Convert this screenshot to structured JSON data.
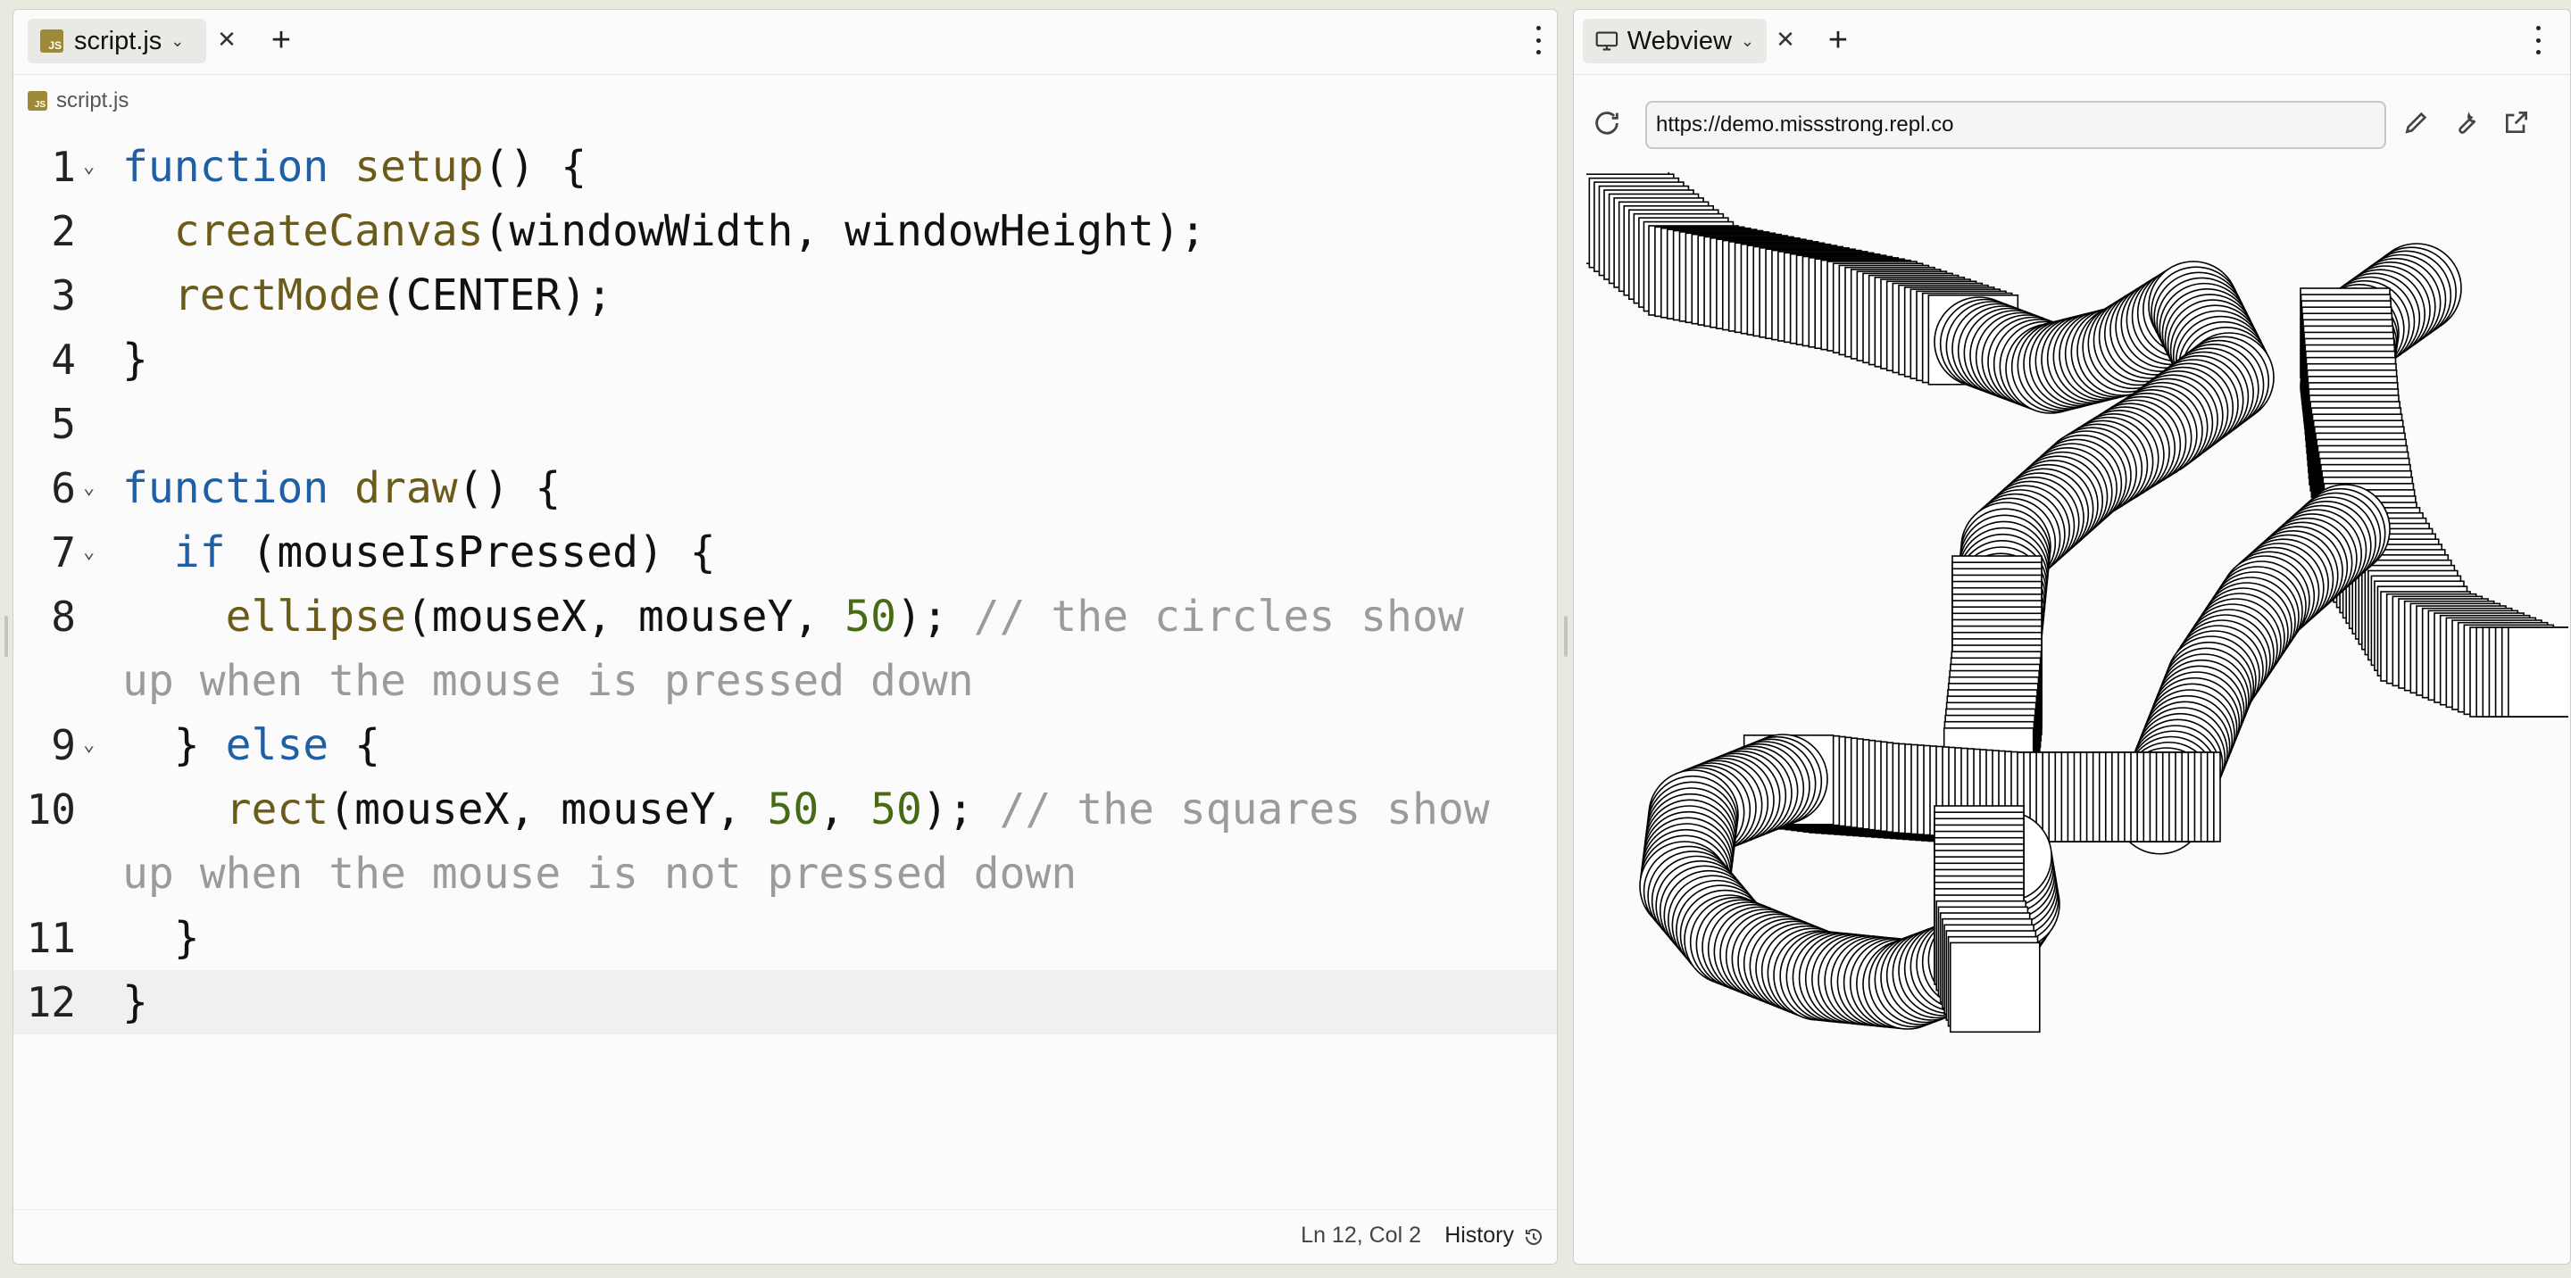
{
  "editor": {
    "tab": {
      "label": "script.js",
      "icon": "js-file-icon",
      "icon_text": "JS"
    },
    "breadcrumb": "script.js",
    "active_line": 12,
    "lines": [
      {
        "num": "1",
        "fold": true
      },
      {
        "num": "2",
        "fold": false
      },
      {
        "num": "3",
        "fold": false
      },
      {
        "num": "4",
        "fold": false
      },
      {
        "num": "5",
        "fold": false
      },
      {
        "num": "6",
        "fold": true
      },
      {
        "num": "7",
        "fold": true
      },
      {
        "num": "8",
        "fold": false
      },
      {
        "num": "9",
        "fold": true
      },
      {
        "num": "10",
        "fold": false
      },
      {
        "num": "11",
        "fold": false
      },
      {
        "num": "12",
        "fold": false
      }
    ],
    "code": {
      "l1": [
        "function",
        " ",
        "setup",
        "() {"
      ],
      "l2": [
        "  ",
        "createCanvas",
        "(windowWidth, windowHeight);"
      ],
      "l3": [
        "  ",
        "rectMode",
        "(CENTER);"
      ],
      "l4": [
        "}"
      ],
      "l6": [
        "function",
        " ",
        "draw",
        "() {"
      ],
      "l7": [
        "  ",
        "if",
        " (mouseIsPressed) {"
      ],
      "l8": [
        "    ",
        "ellipse",
        "(mouseX, mouseY, ",
        "50",
        "); ",
        "// the circles show up when the mouse is pressed down"
      ],
      "l9": [
        "  } ",
        "else",
        " {"
      ],
      "l10": [
        "    ",
        "rect",
        "(mouseX, mouseY, ",
        "50",
        ", ",
        "50",
        "); ",
        "// the squares show up when the mouse is not pressed down"
      ],
      "l11": [
        "  }"
      ],
      "l12": [
        "}"
      ]
    },
    "status": {
      "position": "Ln 12, Col 2",
      "history_label": "History"
    }
  },
  "webview": {
    "tab": {
      "label": "Webview",
      "icon": "monitor-icon"
    },
    "url": "https://demo.missstrong.repl.co"
  },
  "colors": {
    "keyword": "#1f5fa6",
    "function": "#6b5b1a",
    "number": "#476b14",
    "comment": "#9b9b9b",
    "js_icon": "#9c8a38"
  }
}
